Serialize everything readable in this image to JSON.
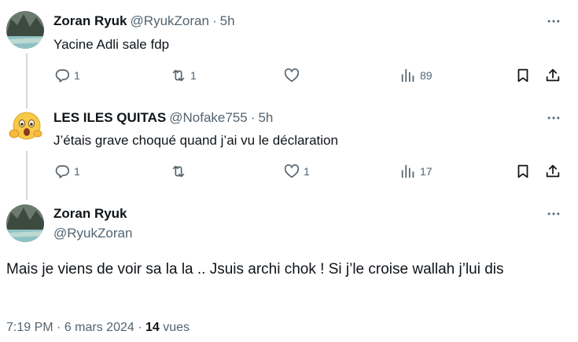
{
  "reply1": {
    "name": "Zoran Ryuk",
    "handle": "@RyukZoran",
    "separator": "·",
    "time": "5h",
    "text": "Yacine Adli sale fdp",
    "replies": "1",
    "retweets": "1",
    "likes": "",
    "views": "89"
  },
  "reply2": {
    "name": "LES ILES QUITAS",
    "handle": "@Nofake755",
    "separator": "·",
    "time": "5h",
    "text": "J’étais grave choqué quand j’ai vu le déclaration",
    "replies": "1",
    "retweets": "",
    "likes": "1",
    "views": "17"
  },
  "main_tweet": {
    "name": "Zoran Ryuk",
    "handle": "@RyukZoran",
    "text": "Mais je viens de voir sa la la .. Jsuis archi chok ! Si j’le croise wallah j’lui dis",
    "time": "7:19 PM",
    "date": "6 mars 2024",
    "separator": "·",
    "views_count": "14",
    "views_label": "vues"
  },
  "icons": {
    "reply": "reply-icon",
    "retweet": "retweet-icon",
    "like": "heart-icon",
    "views": "views-chart-icon",
    "bookmark": "bookmark-icon",
    "share": "share-icon",
    "more": "more-dots-icon"
  },
  "colors": {
    "text": "#0f1419",
    "secondary": "#536471",
    "thread_line": "#cfd9de"
  }
}
